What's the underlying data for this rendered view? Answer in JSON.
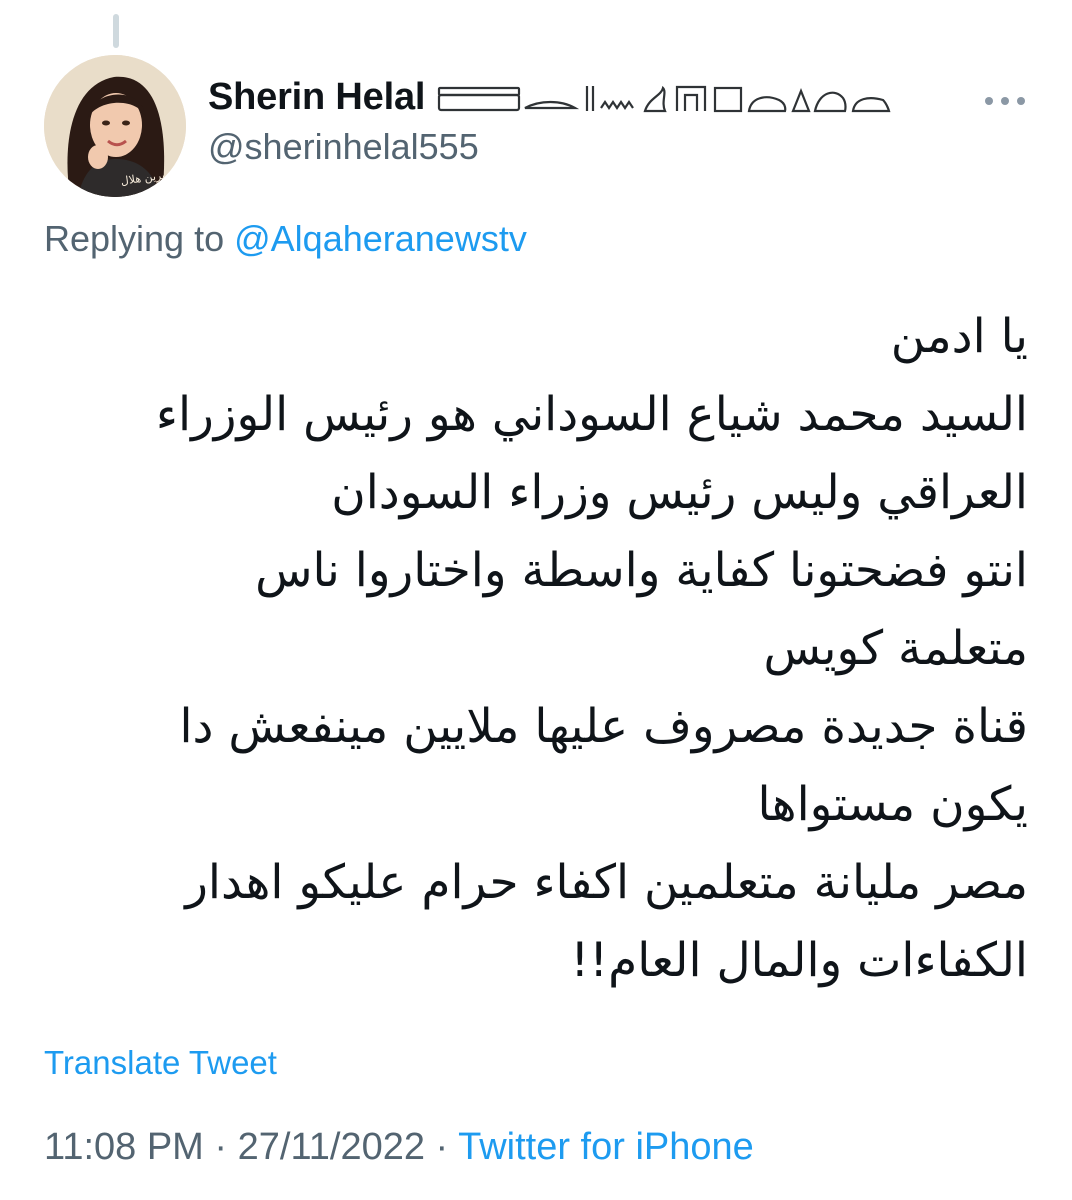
{
  "author": {
    "display_name": "Sherin Helal",
    "handle": "@sherinhelal555",
    "avatar_signature": "شيرين هلال"
  },
  "reply": {
    "prefix": "Replying to",
    "handle": "@Alqaheranewstv"
  },
  "tweet": {
    "lines": [
      "يا ادمن",
      "السيد محمد شياع السوداني هو رئيس الوزراء",
      "العراقي وليس رئيس وزراء السودان",
      "انتو فضحتونا كفاية واسطة واختاروا ناس",
      "متعلمة كويس",
      "قناة جديدة مصروف عليها ملايين مينفعش دا",
      "يكون مستواها",
      "مصر مليانة متعلمين اكفاء حرام عليكو اهدار",
      "الكفاءات والمال العام!!"
    ]
  },
  "translate_label": "Translate Tweet",
  "meta": {
    "time": "11:08 PM",
    "separator": " · ",
    "date": "27/11/2022",
    "source": "Twitter for iPhone"
  },
  "icons": {
    "more": "more-horizontal-icon",
    "name_glyphs": "hieroglyph-glyphs"
  },
  "colors": {
    "link": "#1d9bf0",
    "secondary_text": "#536471",
    "primary_text": "#0f1419"
  }
}
